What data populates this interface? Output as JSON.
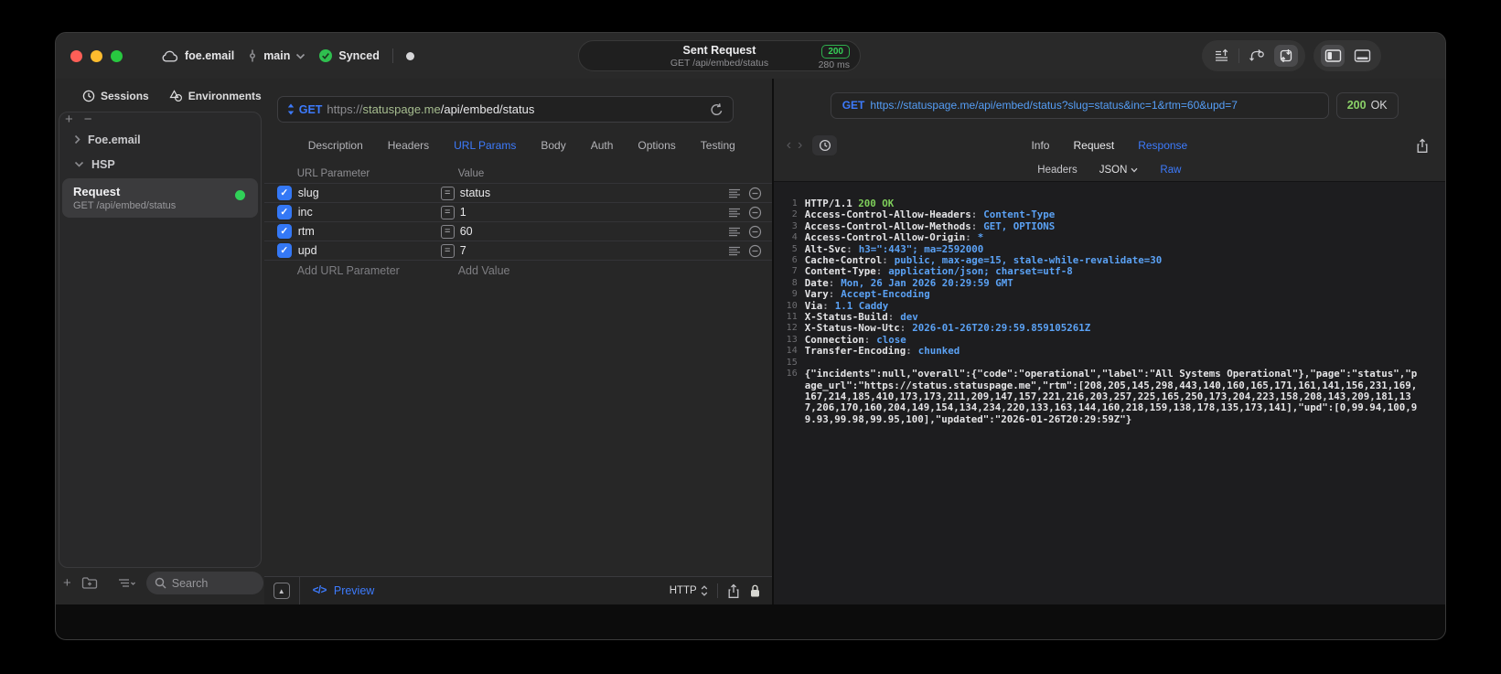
{
  "titlebar": {
    "project": "foe.email",
    "branch": "main",
    "sync_status": "Synced",
    "request_title": "Sent Request",
    "request_subtitle": "GET /api/embed/status",
    "status_code": "200",
    "duration": "280 ms"
  },
  "sidebar": {
    "tabs": [
      {
        "label": "Sessions"
      },
      {
        "label": "Environments"
      }
    ],
    "tree": [
      {
        "label": "Foe.email"
      },
      {
        "label": "HSP"
      }
    ],
    "request_item": {
      "title": "Request",
      "subtitle": "GET /api/embed/status"
    },
    "search_placeholder": "Search"
  },
  "request_panel": {
    "method": "GET",
    "url": {
      "scheme": "https://",
      "host": "statuspage.me",
      "path": "/api/embed/status"
    },
    "tabs": [
      {
        "label": "Description"
      },
      {
        "label": "Headers"
      },
      {
        "label": "URL Params"
      },
      {
        "label": "Body"
      },
      {
        "label": "Auth"
      },
      {
        "label": "Options"
      },
      {
        "label": "Testing"
      }
    ],
    "active_tab": "URL Params",
    "table": {
      "col_param": "URL Parameter",
      "col_value": "Value",
      "rows": [
        {
          "name": "slug",
          "value": "status"
        },
        {
          "name": "inc",
          "value": "1"
        },
        {
          "name": "rtm",
          "value": "60"
        },
        {
          "name": "upd",
          "value": "7"
        }
      ],
      "add_param": "Add URL Parameter",
      "add_value": "Add Value"
    },
    "footer": {
      "preview": "Preview",
      "protocol": "HTTP"
    }
  },
  "response_panel": {
    "method": "GET",
    "url": "https://statuspage.me/api/embed/status?slug=status&inc=1&rtm=60&upd=7",
    "status_code": "200",
    "status_text": "OK",
    "tabs": [
      {
        "label": "Info"
      },
      {
        "label": "Request"
      },
      {
        "label": "Response"
      }
    ],
    "active_tab": "Response",
    "subtabs": [
      {
        "label": "Headers"
      },
      {
        "label": "JSON"
      },
      {
        "label": "Raw"
      }
    ],
    "active_subtab": "Raw",
    "status_line": {
      "num": "1",
      "protocol": "HTTP/1.1 ",
      "status": "200 OK"
    },
    "header_lines": [
      {
        "num": "2",
        "name": "Access-Control-Allow-Headers",
        "value": "Content-Type"
      },
      {
        "num": "3",
        "name": "Access-Control-Allow-Methods",
        "value": "GET, OPTIONS"
      },
      {
        "num": "4",
        "name": "Access-Control-Allow-Origin",
        "value": "*"
      },
      {
        "num": "5",
        "name": "Alt-Svc",
        "value": "h3=\":443\"; ma=2592000"
      },
      {
        "num": "6",
        "name": "Cache-Control",
        "value": "public, max-age=15, stale-while-revalidate=30"
      },
      {
        "num": "7",
        "name": "Content-Type",
        "value": "application/json; charset=utf-8"
      },
      {
        "num": "8",
        "name": "Date",
        "value": "Mon, 26 Jan 2026 20:29:59 GMT"
      },
      {
        "num": "9",
        "name": "Vary",
        "value": "Accept-Encoding"
      },
      {
        "num": "10",
        "name": "Via",
        "value": "1.1 Caddy"
      },
      {
        "num": "11",
        "name": "X-Status-Build",
        "value": "dev"
      },
      {
        "num": "12",
        "name": "X-Status-Now-Utc",
        "value": "2026-01-26T20:29:59.859105261Z"
      },
      {
        "num": "13",
        "name": "Connection",
        "value": "close"
      },
      {
        "num": "14",
        "name": "Transfer-Encoding",
        "value": "chunked"
      }
    ],
    "blank_line_num": "15",
    "body_line_num": "16",
    "body": "{\"incidents\":null,\"overall\":{\"code\":\"operational\",\"label\":\"All Systems Operational\"},\"page\":\"status\",\"page_url\":\"https://status.statuspage.me\",\"rtm\":[208,205,145,298,443,140,160,165,171,161,141,156,231,169,167,214,185,410,173,173,211,209,147,157,221,216,203,257,225,165,250,173,204,223,158,208,143,209,181,137,206,170,160,204,149,154,134,234,220,133,163,144,160,218,159,138,178,135,173,141],\"upd\":[0,99.94,100,99.93,99.98,99.95,100],\"updated\":\"2026-01-26T20:29:59Z\"}"
  },
  "glyphs": {
    "plus": "+",
    "minus": "−",
    "equals": "=",
    "check": "✓",
    "triangle_up": "▲",
    "code": "</>",
    "back": "‹",
    "forward": "›"
  },
  "colors": {
    "accent_blue": "#3d7bfd",
    "value_blue": "#559ef6",
    "badge_green": "#30d158",
    "response_green": "#7ece5a",
    "domain_green": "#a6bd8f",
    "checkbox_blue": "#3478f6"
  }
}
